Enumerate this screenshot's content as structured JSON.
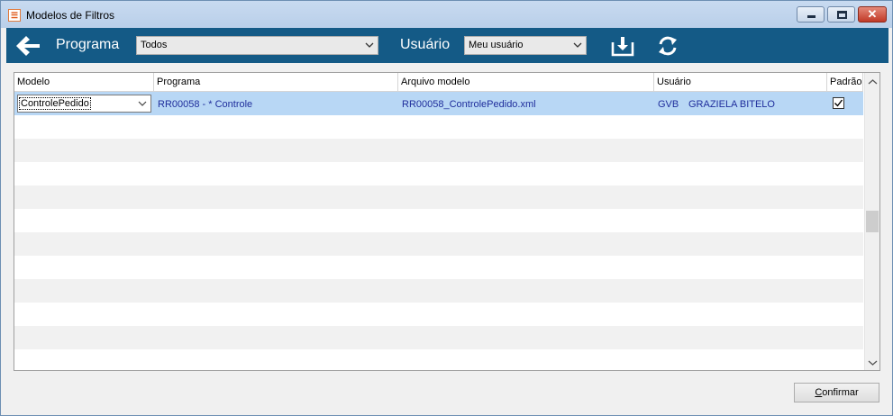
{
  "window": {
    "title": "Modelos de Filtros"
  },
  "toolbar": {
    "programa_label": "Programa",
    "programa_value": "Todos",
    "usuario_label": "Usuário",
    "usuario_value": "Meu usuário",
    "back_icon": "arrow-left-icon",
    "download_icon": "download-icon",
    "refresh_icon": "refresh-icon",
    "background_color": "#145a86"
  },
  "grid": {
    "columns": [
      "Modelo",
      "Programa",
      "Arquivo modelo",
      "Usuário",
      "Padrão"
    ],
    "rows": [
      {
        "modelo": "ControlePedido",
        "programa": "RR00058 - * Controle",
        "arquivo": "RR00058_ControlePedido.xml",
        "usuario_code": "GVB",
        "usuario_name": "GRAZIELA BITELO",
        "padrao": true
      }
    ],
    "selected_row_color": "#b8d7f5",
    "text_color": "#1f2e9c"
  },
  "footer": {
    "confirm_accel": "C",
    "confirm_rest": "onfirmar"
  }
}
